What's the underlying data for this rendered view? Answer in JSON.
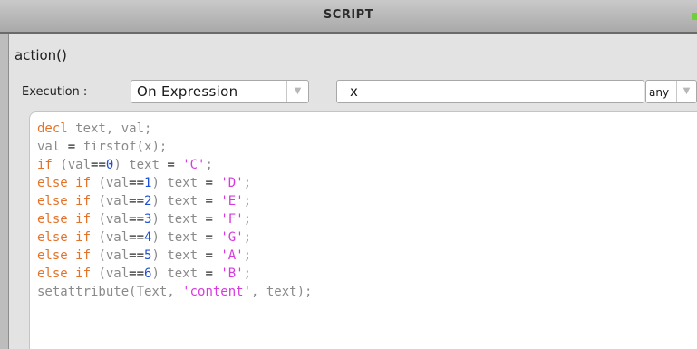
{
  "window": {
    "title": "SCRIPT"
  },
  "action": {
    "name": "action()"
  },
  "execution": {
    "label": "Execution :",
    "mode": "On Expression",
    "expression": "x",
    "trigger": "any"
  },
  "code": {
    "lines": [
      [
        {
          "t": "kw",
          "v": "decl"
        },
        {
          "t": "id",
          "v": " text, val;"
        }
      ],
      [
        {
          "t": "id",
          "v": "val "
        },
        {
          "t": "op",
          "v": "="
        },
        {
          "t": "id",
          "v": " firstof(x);"
        }
      ],
      [
        {
          "t": "kw",
          "v": "if"
        },
        {
          "t": "id",
          "v": " (val"
        },
        {
          "t": "op",
          "v": "=="
        },
        {
          "t": "num",
          "v": "0"
        },
        {
          "t": "id",
          "v": ") text "
        },
        {
          "t": "op",
          "v": "="
        },
        {
          "t": "id",
          "v": " "
        },
        {
          "t": "str",
          "v": "'C'"
        },
        {
          "t": "id",
          "v": ";"
        }
      ],
      [
        {
          "t": "kw",
          "v": "else if"
        },
        {
          "t": "id",
          "v": " (val"
        },
        {
          "t": "op",
          "v": "=="
        },
        {
          "t": "num",
          "v": "1"
        },
        {
          "t": "id",
          "v": ") text "
        },
        {
          "t": "op",
          "v": "="
        },
        {
          "t": "id",
          "v": " "
        },
        {
          "t": "str",
          "v": "'D'"
        },
        {
          "t": "id",
          "v": ";"
        }
      ],
      [
        {
          "t": "kw",
          "v": "else if"
        },
        {
          "t": "id",
          "v": " (val"
        },
        {
          "t": "op",
          "v": "=="
        },
        {
          "t": "num",
          "v": "2"
        },
        {
          "t": "id",
          "v": ") text "
        },
        {
          "t": "op",
          "v": "="
        },
        {
          "t": "id",
          "v": " "
        },
        {
          "t": "str",
          "v": "'E'"
        },
        {
          "t": "id",
          "v": ";"
        }
      ],
      [
        {
          "t": "kw",
          "v": "else if"
        },
        {
          "t": "id",
          "v": " (val"
        },
        {
          "t": "op",
          "v": "=="
        },
        {
          "t": "num",
          "v": "3"
        },
        {
          "t": "id",
          "v": ") text "
        },
        {
          "t": "op",
          "v": "="
        },
        {
          "t": "id",
          "v": " "
        },
        {
          "t": "str",
          "v": "'F'"
        },
        {
          "t": "id",
          "v": ";"
        }
      ],
      [
        {
          "t": "kw",
          "v": "else if"
        },
        {
          "t": "id",
          "v": " (val"
        },
        {
          "t": "op",
          "v": "=="
        },
        {
          "t": "num",
          "v": "4"
        },
        {
          "t": "id",
          "v": ") text "
        },
        {
          "t": "op",
          "v": "="
        },
        {
          "t": "id",
          "v": " "
        },
        {
          "t": "str",
          "v": "'G'"
        },
        {
          "t": "id",
          "v": ";"
        }
      ],
      [
        {
          "t": "kw",
          "v": "else if"
        },
        {
          "t": "id",
          "v": " (val"
        },
        {
          "t": "op",
          "v": "=="
        },
        {
          "t": "num",
          "v": "5"
        },
        {
          "t": "id",
          "v": ") text "
        },
        {
          "t": "op",
          "v": "="
        },
        {
          "t": "id",
          "v": " "
        },
        {
          "t": "str",
          "v": "'A'"
        },
        {
          "t": "id",
          "v": ";"
        }
      ],
      [
        {
          "t": "kw",
          "v": "else if"
        },
        {
          "t": "id",
          "v": " (val"
        },
        {
          "t": "op",
          "v": "=="
        },
        {
          "t": "num",
          "v": "6"
        },
        {
          "t": "id",
          "v": ") text "
        },
        {
          "t": "op",
          "v": "="
        },
        {
          "t": "id",
          "v": " "
        },
        {
          "t": "str",
          "v": "'B'"
        },
        {
          "t": "id",
          "v": ";"
        }
      ],
      [
        {
          "t": "id",
          "v": "setattribute(Text, "
        },
        {
          "t": "str",
          "v": "'content'"
        },
        {
          "t": "id",
          "v": ", text);"
        }
      ]
    ]
  },
  "colors": {
    "keyword": "#e4732a",
    "number": "#1d4fd6",
    "string": "#d83adf",
    "identifier": "#8a8a8a",
    "maximize_button": "#6fcf3a"
  },
  "icons": {
    "dropdown": "chevron-down-icon",
    "window_button": "maximize-icon"
  }
}
